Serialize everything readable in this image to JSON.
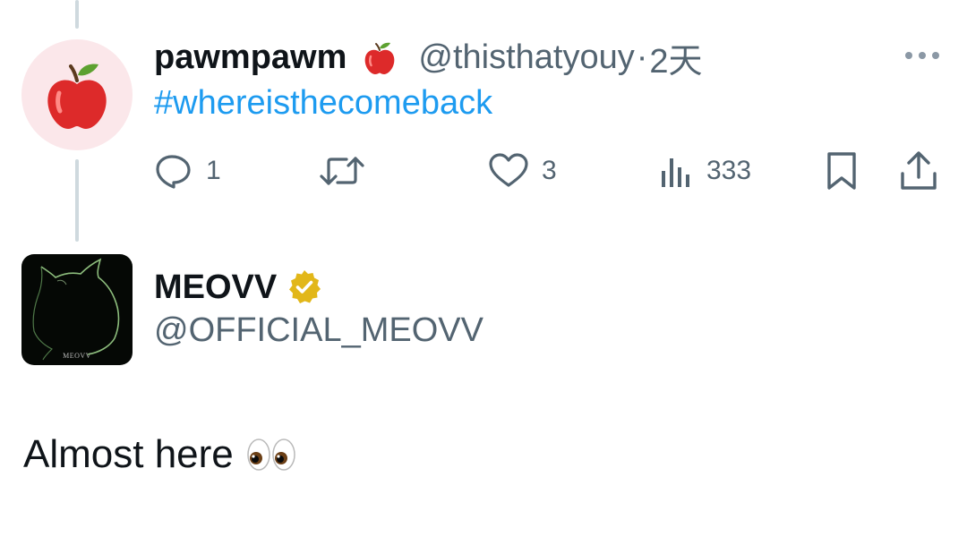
{
  "reply_tweet": {
    "author": {
      "display_name": "pawmpawm",
      "handle": "@thisthatyouy",
      "name_emoji": "red-apple-emoji",
      "avatar_icon": "red-apple-emoji"
    },
    "separator": "·",
    "time": "2天",
    "text": "#whereisthecomeback",
    "actions": {
      "reply_count": "1",
      "retweet_count": "",
      "like_count": "3",
      "views_count": "333"
    }
  },
  "quoted_account": {
    "display_name": "MEOVV",
    "handle": "@OFFICIAL_MEOVV",
    "verified_badge": "gold-verified-badge",
    "avatar_logo_text": "MEOVV"
  },
  "post": {
    "text": "Almost here",
    "emoji": "eyes-emoji"
  },
  "colors": {
    "link_blue": "#1d9bf0",
    "muted_gray": "#536471",
    "text_dark": "#0f1419",
    "thread_line": "#cfd9de",
    "verified_gold": "#e2b719"
  }
}
